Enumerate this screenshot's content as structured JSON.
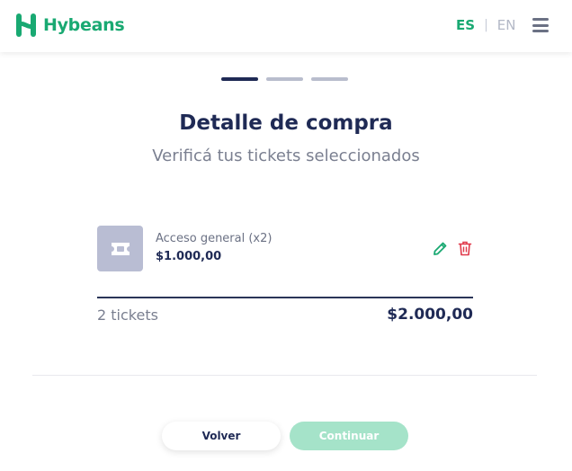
{
  "header": {
    "brand": "Hybeans",
    "lang_active": "ES",
    "lang_separator": "|",
    "lang_inactive": "EN",
    "brand_color": "#19a972"
  },
  "steps": {
    "total": 3,
    "current": 1
  },
  "main": {
    "title": "Detalle de compra",
    "subtitle": "Verificá tus tickets seleccionados"
  },
  "cart": {
    "items": [
      {
        "name": "Acceso general (x2)",
        "price": "$1.000,00",
        "icon": "ticket-icon"
      }
    ],
    "total_count": "2 tickets",
    "total_amount": "$2.000,00"
  },
  "actions": {
    "back_label": "Volver",
    "continue_label": "Continuar"
  },
  "colors": {
    "accent": "#19a972",
    "navy": "#1f2a55",
    "danger": "#e0394a",
    "disabled": "#a5e3c9"
  }
}
